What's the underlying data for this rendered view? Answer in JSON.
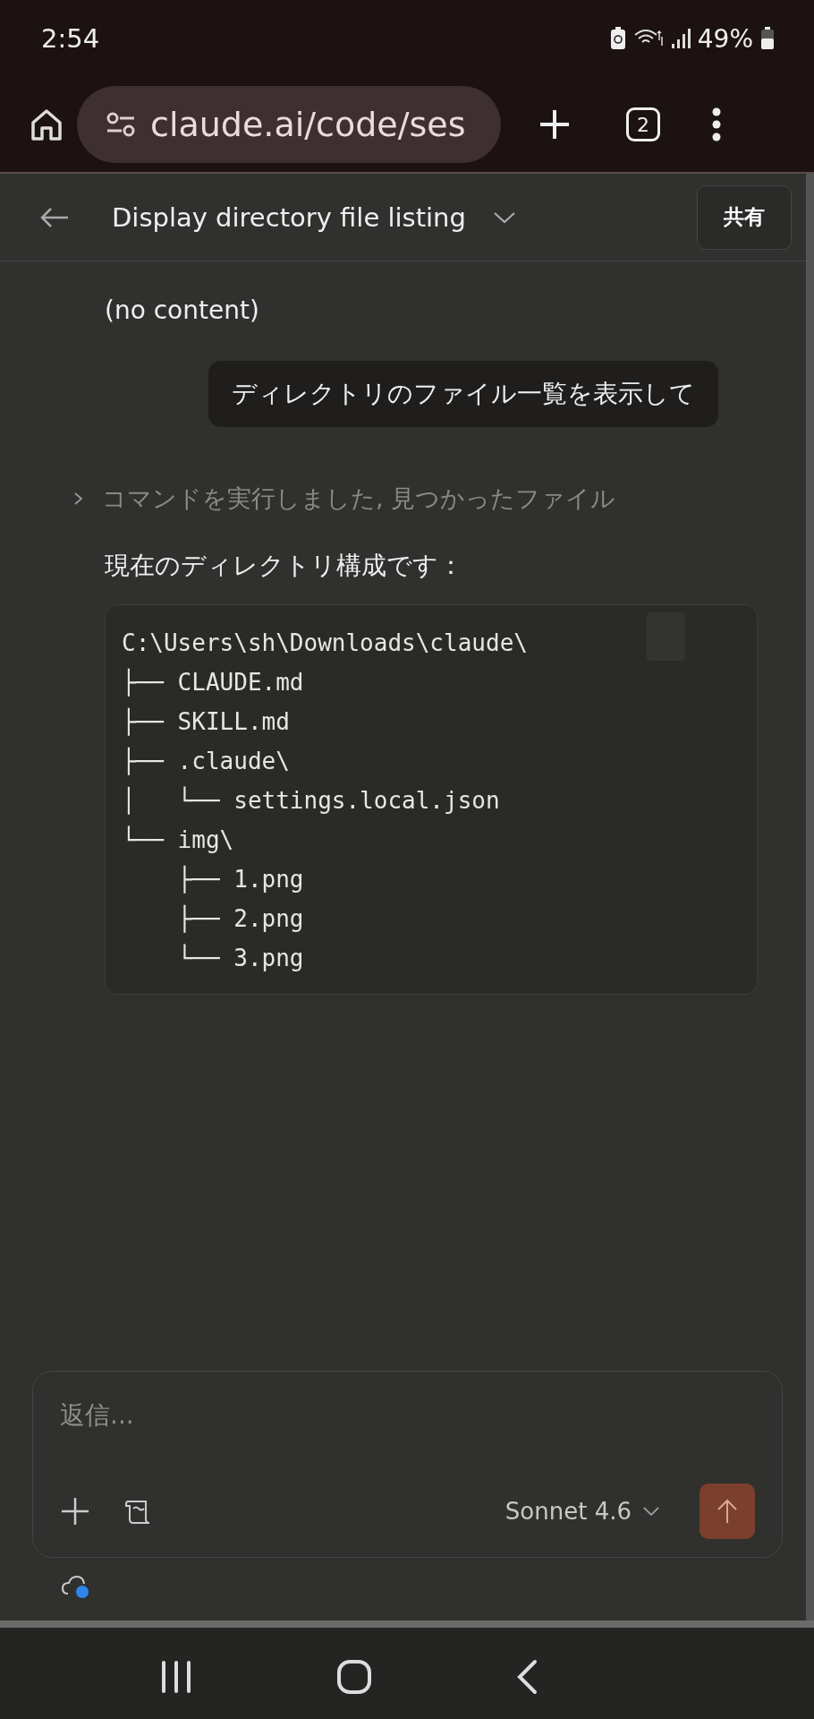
{
  "status_bar": {
    "time": "2:54",
    "battery": "49%"
  },
  "browser": {
    "url": "claude.ai/code/ses",
    "tab_count": "2"
  },
  "header": {
    "title": "Display directory file listing",
    "share_button": "共有"
  },
  "messages": [
    {
      "kind": "assistant",
      "text": "(no content)"
    },
    {
      "kind": "user",
      "text": "ディレクトリのファイル一覧を表示して"
    },
    {
      "kind": "tool",
      "text": "コマンドを実行しました, 見つかったファイル",
      "expanded": false
    },
    {
      "kind": "assistant",
      "text": "現在のディレクトリ構成です："
    },
    {
      "kind": "code",
      "lines": [
        "C:\\Users\\sh\\Downloads\\claude\\",
        "├── CLAUDE.md",
        "├── SKILL.md",
        "├── .claude\\",
        "│   └── settings.local.json",
        "└── img\\",
        "    ├── 1.png",
        "    ├── 2.png",
        "    └── 3.png"
      ]
    }
  ],
  "composer": {
    "placeholder": "返信...",
    "model": "Sonnet 4.6"
  }
}
